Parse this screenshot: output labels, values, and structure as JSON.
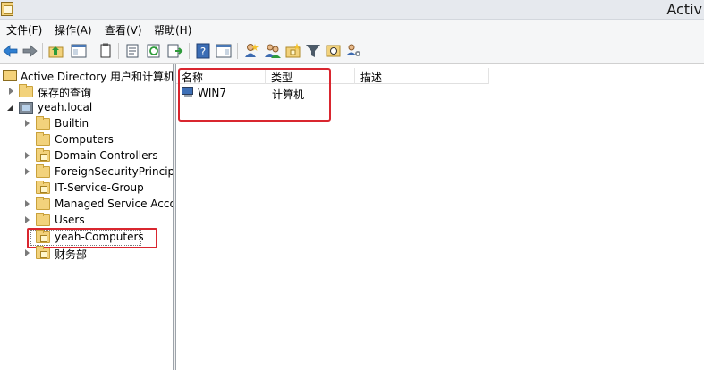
{
  "window": {
    "title": "Activ"
  },
  "menu": [
    "文件(F)",
    "操作(A)",
    "查看(V)",
    "帮助(H)"
  ],
  "toolbar": {
    "icons": [
      "back-icon",
      "forward-icon",
      "up-folder-icon",
      "console-tree-icon",
      "copy-icon",
      "properties-icon",
      "refresh-icon",
      "export-list-icon",
      "help-icon",
      "action-pane-icon",
      "new-user-icon",
      "new-group-icon",
      "new-ou-icon",
      "filter-icon",
      "find-icon",
      "add-to-group-icon"
    ]
  },
  "tree": {
    "root": "Active Directory 用户和计算机",
    "saved_queries": "保存的查询",
    "domain": "yeah.local",
    "children": [
      "Builtin",
      "Computers",
      "Domain Controllers",
      "ForeignSecurityPrincipals",
      "IT-Service-Group",
      "Managed Service Accounts",
      "Users",
      "yeah-Computers",
      "财务部"
    ]
  },
  "list": {
    "columns": [
      "名称",
      "类型",
      "描述"
    ],
    "rows": [
      {
        "name": "WIN7",
        "type": "计算机",
        "description": ""
      }
    ]
  }
}
